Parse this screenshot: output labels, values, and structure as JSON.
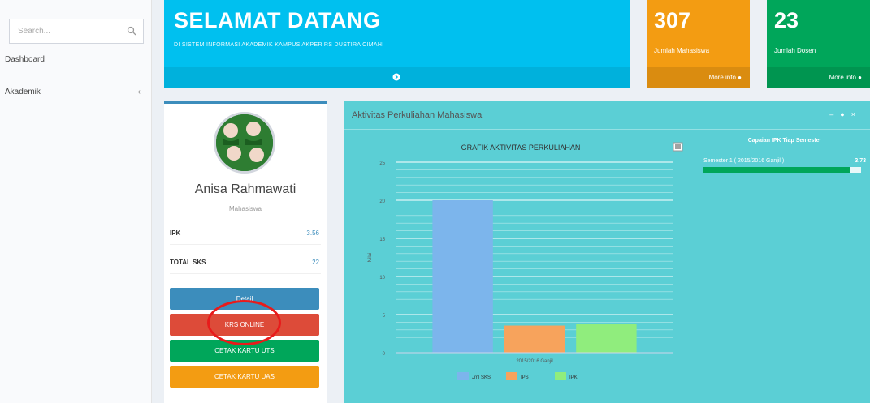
{
  "sidebar": {
    "search_placeholder": "Search...",
    "items": [
      {
        "label": "Dashboard"
      },
      {
        "label": "Akademik"
      }
    ]
  },
  "banner": {
    "title": "SELAMAT DATANG",
    "subtitle": "DI SISTEM INFORMASI AKADEMIK KAMPUS AKPER RS DUSTIRA CIMAHI"
  },
  "stats": [
    {
      "value": "307",
      "label": "Jumlah Mahasiswa",
      "link": "More info",
      "color": "#f39c12"
    },
    {
      "value": "23",
      "label": "Jumlah Dosen",
      "link": "More info",
      "color": "#00a65a"
    }
  ],
  "profile": {
    "name": "Anisa Rahmawati",
    "role": "Mahasiswa",
    "rows": [
      {
        "label": "IPK",
        "value": "3.56"
      },
      {
        "label": "TOTAL SKS",
        "value": "22"
      }
    ],
    "buttons": [
      {
        "label": "Detail",
        "color": "#3c8dbc"
      },
      {
        "label": "KRS ONLINE",
        "color": "#dd4b39"
      },
      {
        "label": "CETAK KARTU UTS",
        "color": "#00a65a"
      },
      {
        "label": "CETAK KARTU UAS",
        "color": "#f39c12"
      }
    ]
  },
  "panel": {
    "title": "Aktivitas Perkuliahan Mahasiswa",
    "ipk_title": "Capaian IPK Tiap Semester",
    "ipk_item": {
      "label": "Semester 1 ( 2015/2016 Ganjil )",
      "value": "3.73",
      "fraction": 0.93
    }
  },
  "chart_data": {
    "type": "bar",
    "title": "GRAFIK AKTIVITAS PERKULIAHAN",
    "categories": [
      "2015/2016 Ganjil"
    ],
    "series": [
      {
        "name": "Jml SKS",
        "values": [
          20
        ],
        "color": "#7cb5ec"
      },
      {
        "name": "IPS",
        "values": [
          3.56
        ],
        "color": "#f7a35c"
      },
      {
        "name": "IPK",
        "values": [
          3.73
        ],
        "color": "#90ed7d"
      }
    ],
    "ylim": [
      0,
      25
    ],
    "yticks": [
      0,
      5,
      10,
      15,
      20,
      25
    ],
    "ylabel": "Nilai",
    "legend": "bottom",
    "grid": true
  }
}
